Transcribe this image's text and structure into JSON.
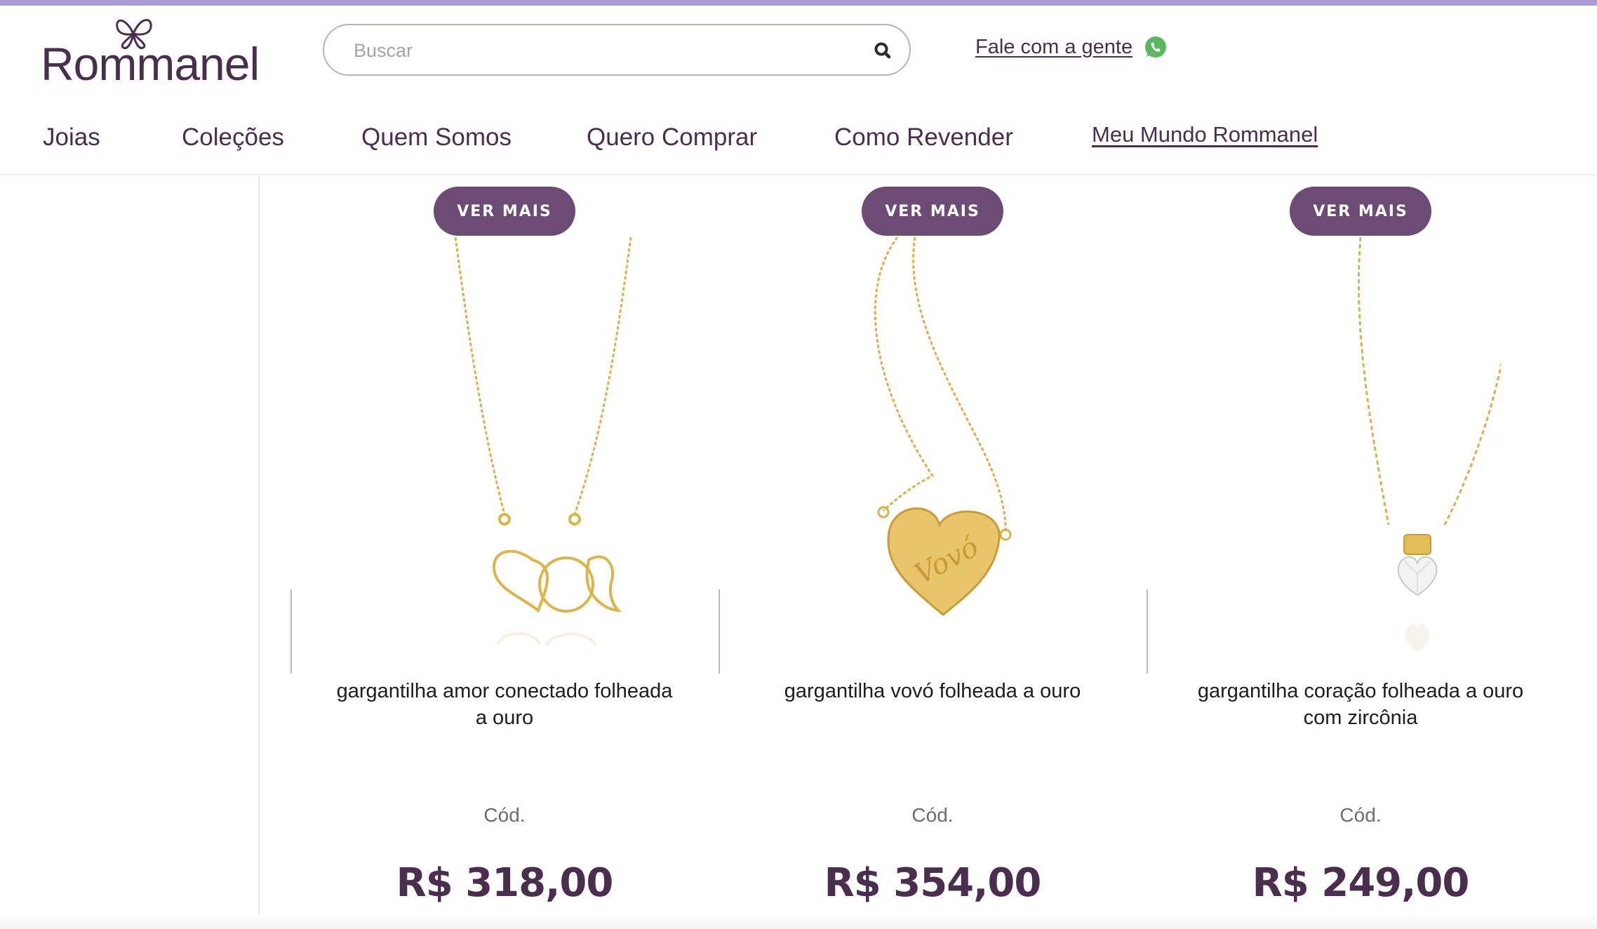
{
  "brand": {
    "name": "Rommanel",
    "color": "#4a2e4e",
    "accent": "#6c4b74",
    "stripe": "#a99ad6"
  },
  "search": {
    "placeholder": "Buscar",
    "icon": "search-icon"
  },
  "contact": {
    "label": "Fale com a gente",
    "icon": "whatsapp-icon",
    "icon_color": "#5cb85c"
  },
  "nav": {
    "items": [
      "Joias",
      "Coleções",
      "Quem Somos",
      "Quero Comprar",
      "Como Revender"
    ],
    "highlight_link": "Meu Mundo Rommanel"
  },
  "products": [
    {
      "button": "VER MAIS",
      "name": "gargantilha amor conectado folheada a ouro",
      "code_label": "Cód.",
      "price": "R$ 318,00"
    },
    {
      "button": "VER MAIS",
      "name": "gargantilha vovó folheada a ouro",
      "code_label": "Cód.",
      "price": "R$ 354,00"
    },
    {
      "button": "VER MAIS",
      "name": "gargantilha coração folheada a ouro com zircônia",
      "code_label": "Cód.",
      "price": "R$ 249,00"
    }
  ]
}
